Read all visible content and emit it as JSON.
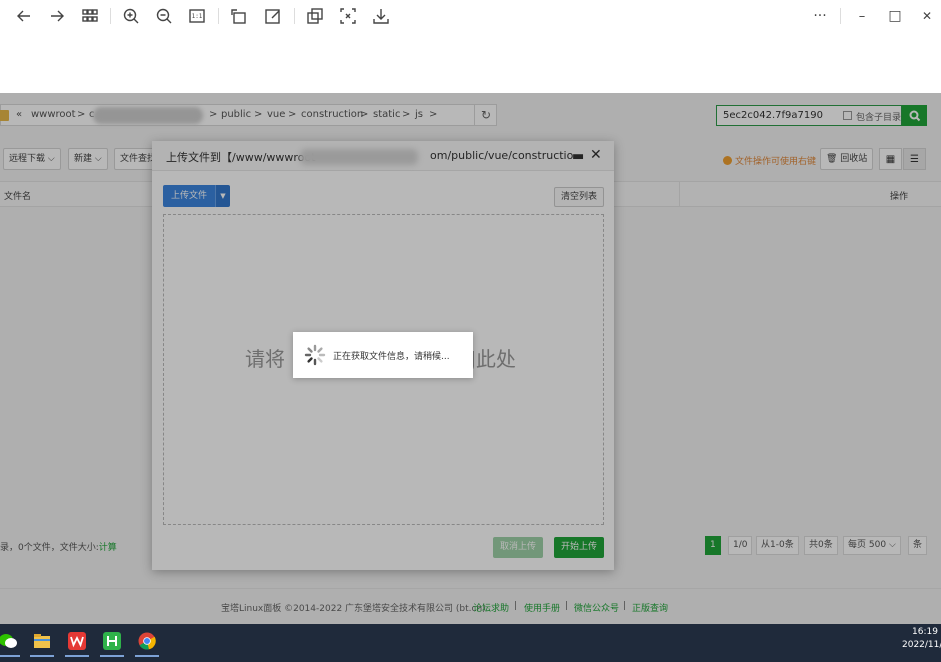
{
  "viewer": {
    "toolbar": [
      "back",
      "forward",
      "grid",
      "zoom-in",
      "zoom-out",
      "actual-size",
      "rotate",
      "edit",
      "copy",
      "crop",
      "save"
    ],
    "actual_size_label": "1:1",
    "more": "···",
    "minimize": "–",
    "maximize": "□",
    "close": "✕"
  },
  "file_manager": {
    "path": {
      "back": "«",
      "crumbs": [
        "wwwroot",
        "c",
        "public",
        "vue",
        "construction",
        "static",
        "js"
      ],
      "sep": ">"
    },
    "search": {
      "value": "5ec2c042.7f9a7190",
      "include_subdir": "包含子目录"
    },
    "toolbar": {
      "remote_download": "远程下载",
      "new": "新建",
      "file_search": "文件查找"
    },
    "notice": "文件操作可使用右键",
    "recycle_bin": "回收站",
    "columns": {
      "name": "文件名",
      "action": "操作"
    },
    "summary": {
      "text": "录，0个文件，文件大小:",
      "calc": "计算"
    },
    "pager": {
      "current": "1",
      "total_pages": "1/0",
      "range": "从1-0条",
      "count": "共0条",
      "per_page_label": "每页",
      "per_page": "500",
      "unit": "条"
    }
  },
  "footer": {
    "copyright": "宝塔Linux面板 ©2014-2022 广东堡塔安全技术有限公司 (bt.cn)",
    "links": [
      "论坛求助",
      "使用手册",
      "微信公众号",
      "正版查询"
    ],
    "sep": "|"
  },
  "dialog": {
    "title_prefix": "上传文件到【/www/wwwroot",
    "title_suffix": "om/public/vue/constructio...",
    "upload_files": "上传文件",
    "clear_list": "清空列表",
    "drop_left": "请将",
    "drop_right": "J此处",
    "cancel_upload": "取消上传",
    "start_upload": "开始上传"
  },
  "loading": {
    "text": "正在获取文件信息，请稍候..."
  },
  "taskbar": {
    "apps": [
      "wechat",
      "file-explorer",
      "wps",
      "hbuilder",
      "chrome"
    ],
    "time": "16:19",
    "date": "2022/11/"
  },
  "colors": {
    "accent": "#20a53a",
    "primary_button": "#3c86e0",
    "taskbar": "#1f2a3b"
  }
}
